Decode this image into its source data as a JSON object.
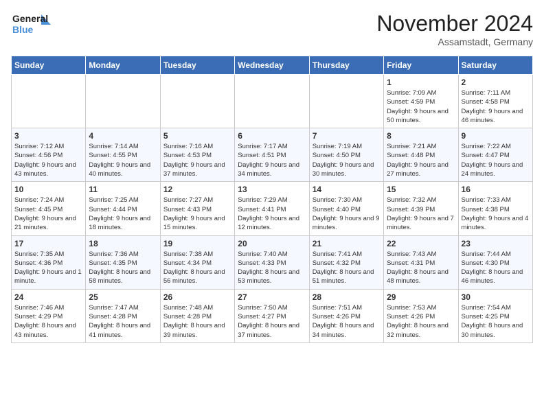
{
  "header": {
    "logo_line1": "General",
    "logo_line2": "Blue",
    "month_title": "November 2024",
    "location": "Assamstadt, Germany"
  },
  "days_of_week": [
    "Sunday",
    "Monday",
    "Tuesday",
    "Wednesday",
    "Thursday",
    "Friday",
    "Saturday"
  ],
  "weeks": [
    [
      {
        "day": "",
        "info": ""
      },
      {
        "day": "",
        "info": ""
      },
      {
        "day": "",
        "info": ""
      },
      {
        "day": "",
        "info": ""
      },
      {
        "day": "",
        "info": ""
      },
      {
        "day": "1",
        "info": "Sunrise: 7:09 AM\nSunset: 4:59 PM\nDaylight: 9 hours and 50 minutes."
      },
      {
        "day": "2",
        "info": "Sunrise: 7:11 AM\nSunset: 4:58 PM\nDaylight: 9 hours and 46 minutes."
      }
    ],
    [
      {
        "day": "3",
        "info": "Sunrise: 7:12 AM\nSunset: 4:56 PM\nDaylight: 9 hours and 43 minutes."
      },
      {
        "day": "4",
        "info": "Sunrise: 7:14 AM\nSunset: 4:55 PM\nDaylight: 9 hours and 40 minutes."
      },
      {
        "day": "5",
        "info": "Sunrise: 7:16 AM\nSunset: 4:53 PM\nDaylight: 9 hours and 37 minutes."
      },
      {
        "day": "6",
        "info": "Sunrise: 7:17 AM\nSunset: 4:51 PM\nDaylight: 9 hours and 34 minutes."
      },
      {
        "day": "7",
        "info": "Sunrise: 7:19 AM\nSunset: 4:50 PM\nDaylight: 9 hours and 30 minutes."
      },
      {
        "day": "8",
        "info": "Sunrise: 7:21 AM\nSunset: 4:48 PM\nDaylight: 9 hours and 27 minutes."
      },
      {
        "day": "9",
        "info": "Sunrise: 7:22 AM\nSunset: 4:47 PM\nDaylight: 9 hours and 24 minutes."
      }
    ],
    [
      {
        "day": "10",
        "info": "Sunrise: 7:24 AM\nSunset: 4:45 PM\nDaylight: 9 hours and 21 minutes."
      },
      {
        "day": "11",
        "info": "Sunrise: 7:25 AM\nSunset: 4:44 PM\nDaylight: 9 hours and 18 minutes."
      },
      {
        "day": "12",
        "info": "Sunrise: 7:27 AM\nSunset: 4:43 PM\nDaylight: 9 hours and 15 minutes."
      },
      {
        "day": "13",
        "info": "Sunrise: 7:29 AM\nSunset: 4:41 PM\nDaylight: 9 hours and 12 minutes."
      },
      {
        "day": "14",
        "info": "Sunrise: 7:30 AM\nSunset: 4:40 PM\nDaylight: 9 hours and 9 minutes."
      },
      {
        "day": "15",
        "info": "Sunrise: 7:32 AM\nSunset: 4:39 PM\nDaylight: 9 hours and 7 minutes."
      },
      {
        "day": "16",
        "info": "Sunrise: 7:33 AM\nSunset: 4:38 PM\nDaylight: 9 hours and 4 minutes."
      }
    ],
    [
      {
        "day": "17",
        "info": "Sunrise: 7:35 AM\nSunset: 4:36 PM\nDaylight: 9 hours and 1 minute."
      },
      {
        "day": "18",
        "info": "Sunrise: 7:36 AM\nSunset: 4:35 PM\nDaylight: 8 hours and 58 minutes."
      },
      {
        "day": "19",
        "info": "Sunrise: 7:38 AM\nSunset: 4:34 PM\nDaylight: 8 hours and 56 minutes."
      },
      {
        "day": "20",
        "info": "Sunrise: 7:40 AM\nSunset: 4:33 PM\nDaylight: 8 hours and 53 minutes."
      },
      {
        "day": "21",
        "info": "Sunrise: 7:41 AM\nSunset: 4:32 PM\nDaylight: 8 hours and 51 minutes."
      },
      {
        "day": "22",
        "info": "Sunrise: 7:43 AM\nSunset: 4:31 PM\nDaylight: 8 hours and 48 minutes."
      },
      {
        "day": "23",
        "info": "Sunrise: 7:44 AM\nSunset: 4:30 PM\nDaylight: 8 hours and 46 minutes."
      }
    ],
    [
      {
        "day": "24",
        "info": "Sunrise: 7:46 AM\nSunset: 4:29 PM\nDaylight: 8 hours and 43 minutes."
      },
      {
        "day": "25",
        "info": "Sunrise: 7:47 AM\nSunset: 4:28 PM\nDaylight: 8 hours and 41 minutes."
      },
      {
        "day": "26",
        "info": "Sunrise: 7:48 AM\nSunset: 4:28 PM\nDaylight: 8 hours and 39 minutes."
      },
      {
        "day": "27",
        "info": "Sunrise: 7:50 AM\nSunset: 4:27 PM\nDaylight: 8 hours and 37 minutes."
      },
      {
        "day": "28",
        "info": "Sunrise: 7:51 AM\nSunset: 4:26 PM\nDaylight: 8 hours and 34 minutes."
      },
      {
        "day": "29",
        "info": "Sunrise: 7:53 AM\nSunset: 4:26 PM\nDaylight: 8 hours and 32 minutes."
      },
      {
        "day": "30",
        "info": "Sunrise: 7:54 AM\nSunset: 4:25 PM\nDaylight: 8 hours and 30 minutes."
      }
    ]
  ]
}
